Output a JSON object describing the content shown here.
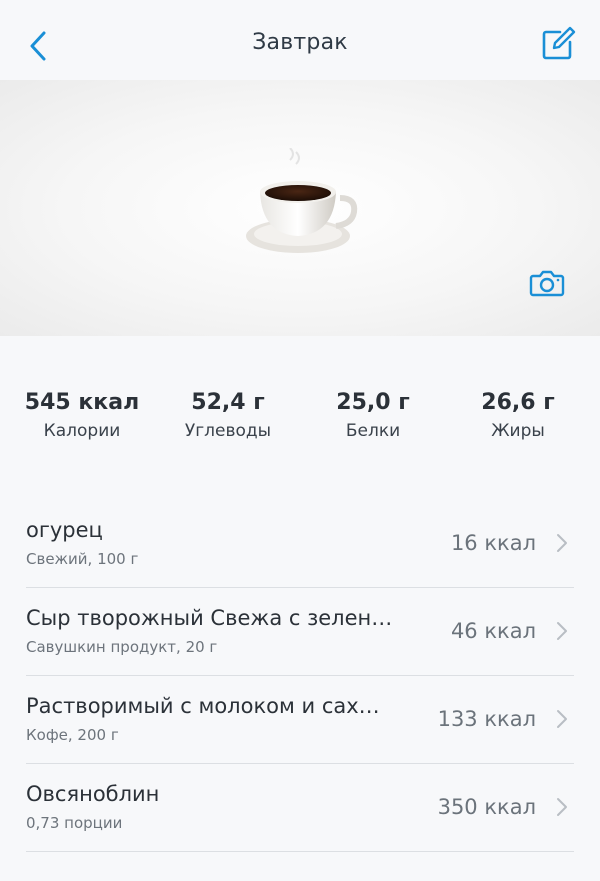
{
  "header": {
    "title": "Завтрак"
  },
  "icons": {
    "back": "chevron-left-icon",
    "edit": "edit-icon",
    "photo": "coffee-cup-icon",
    "camera": "camera-icon",
    "chevron": "chevron-right-icon"
  },
  "colors": {
    "accent": "#1a8fd6",
    "text": "#2b3138",
    "secondary": "#6d747c",
    "divider": "#dcdfe3"
  },
  "stats": [
    {
      "value": "545 ккал",
      "label": "Калории"
    },
    {
      "value": "52,4 г",
      "label": "Углеводы"
    },
    {
      "value": "25,0 г",
      "label": "Белки"
    },
    {
      "value": "26,6 г",
      "label": "Жиры"
    }
  ],
  "items": [
    {
      "name": "огурец",
      "sub": "Свежий, 100 г",
      "kcal": "16 ккал"
    },
    {
      "name": "Сыр творожный Свежа с зелен…",
      "sub": "Савушкин продукт, 20 г",
      "kcal": "46 ккал"
    },
    {
      "name": "Растворимый с молоком и сах…",
      "sub": "Кофе, 200 г",
      "kcal": "133 ккал"
    },
    {
      "name": "Овсяноблин",
      "sub": "0,73 порции",
      "kcal": "350 ккал"
    }
  ]
}
